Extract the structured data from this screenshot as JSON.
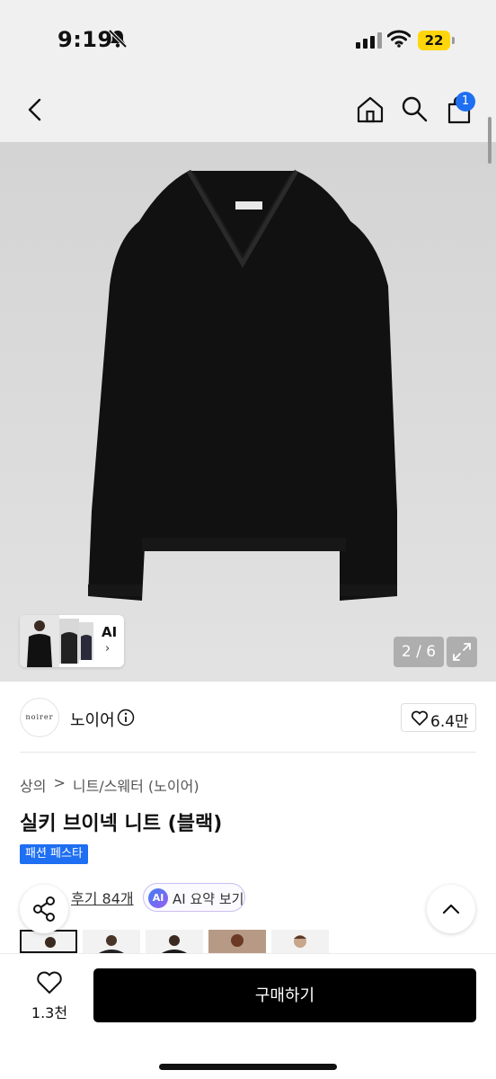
{
  "status_bar": {
    "time": "9:19",
    "battery": "22"
  },
  "nav": {
    "cart_count": "1"
  },
  "gallery": {
    "counter": "2 / 6",
    "ai_label": "AI"
  },
  "brand": {
    "logo_text": "noirer",
    "name": "노이어",
    "likes": "6.4만"
  },
  "breadcrumb": {
    "level1": "상의",
    "separator": ">",
    "level2": "니트/스웨터 (노이어)"
  },
  "product": {
    "title": "실키 브이넥 니트 (블랙)",
    "tag": "패션 페스타"
  },
  "review": {
    "link": "후기 84개",
    "ai_badge": "AI",
    "ai_summary": "AI 요약 보기"
  },
  "bottom_bar": {
    "wish_count": "1.3천",
    "buy_label": "구매하기"
  },
  "colors": {
    "accent": "#1e6ff1",
    "buy_button": "#000000"
  }
}
